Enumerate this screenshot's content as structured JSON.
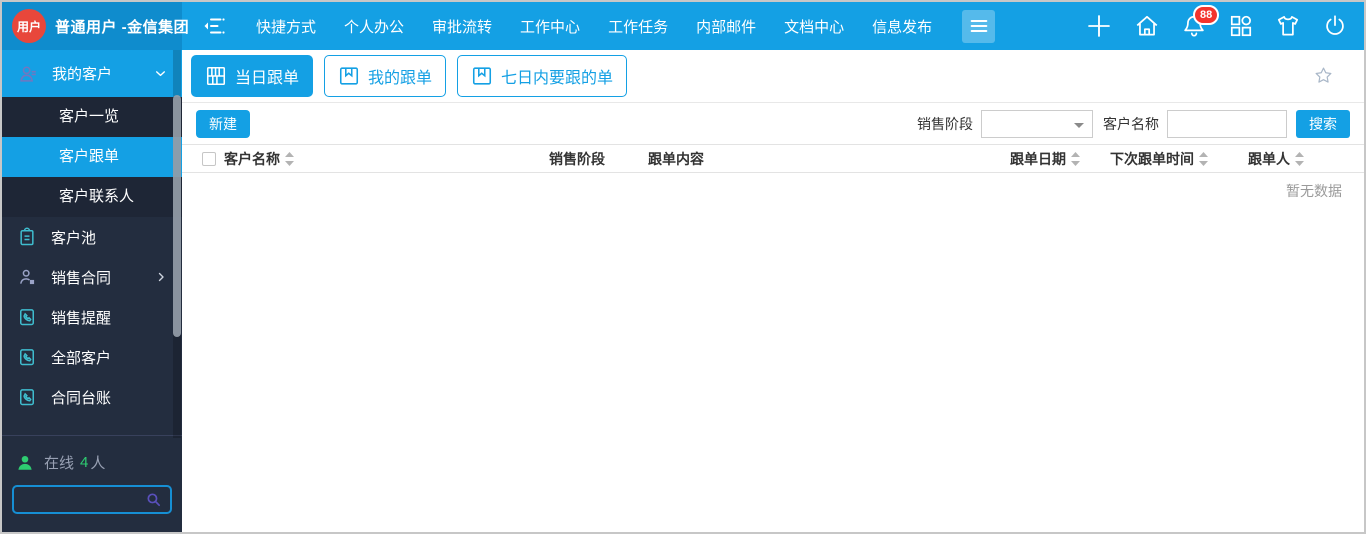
{
  "topbar": {
    "logo_badge": "用户",
    "account_name": "普通用户 -金信集团",
    "nav_items": [
      "快捷方式",
      "个人办公",
      "审批流转",
      "工作中心",
      "工作任务",
      "内部邮件",
      "文档中心",
      "信息发布"
    ],
    "notification_badge": "88",
    "icons": [
      "menu-fold-icon",
      "hamburger-icon",
      "plus-icon",
      "home-icon",
      "bell-icon",
      "apps-grid-icon",
      "tshirt-icon",
      "power-icon"
    ]
  },
  "sidebar": {
    "group": {
      "label": "我的客户",
      "icon": "person-icon",
      "state": "expanded"
    },
    "submenu": [
      "客户一览",
      "客户跟单",
      "客户联系人"
    ],
    "active_submenu": "客户跟单",
    "items": [
      {
        "label": "客户池",
        "icon": "clipboard-icon"
      },
      {
        "label": "销售合同",
        "icon": "person-contract-icon",
        "has_children": true
      },
      {
        "label": "销售提醒",
        "icon": "phone-book-icon"
      },
      {
        "label": "全部客户",
        "icon": "phone-book-icon"
      },
      {
        "label": "合同台账",
        "icon": "phone-book-icon"
      }
    ],
    "online": {
      "label": "在线",
      "count": "4",
      "unit": "人"
    },
    "search": {
      "value": "",
      "icon": "magnifier-icon"
    }
  },
  "main": {
    "tabs": [
      "当日跟单",
      "我的跟单",
      "七日内要跟的单"
    ],
    "active_tab": "当日跟单",
    "favorite_icon": "star-icon",
    "toolbar": {
      "new_button": "新建",
      "stage_label": "销售阶段",
      "stage_value": "",
      "customer_label": "客户名称",
      "customer_value": "",
      "search_button": "搜索"
    },
    "table": {
      "columns": [
        {
          "label": "客户名称",
          "sortable": true
        },
        {
          "label": "销售阶段",
          "sortable": false
        },
        {
          "label": "跟单内容",
          "sortable": false
        },
        {
          "label": "跟单日期",
          "sortable": true
        },
        {
          "label": "下次跟单时间",
          "sortable": true
        },
        {
          "label": "跟单人",
          "sortable": true
        }
      ],
      "rows": [],
      "empty_text": "暂无数据"
    }
  },
  "colors": {
    "topbar_blue": "#14a0e4",
    "userbox_blue": "#0f8ccd",
    "accent_blue": "#14a0e4",
    "sidebar_bg": "#232d3f",
    "submenu_bg": "#1e2636",
    "badge_red": "#f3342d",
    "logo_red": "#e8473b",
    "online_green": "#2ecc71",
    "search_border": "#168fd4",
    "magnifier_purple": "#5a50bc",
    "sidebar_icon_cyan": "#3fbdcf",
    "empty_text_gray": "#9a9a9a"
  }
}
